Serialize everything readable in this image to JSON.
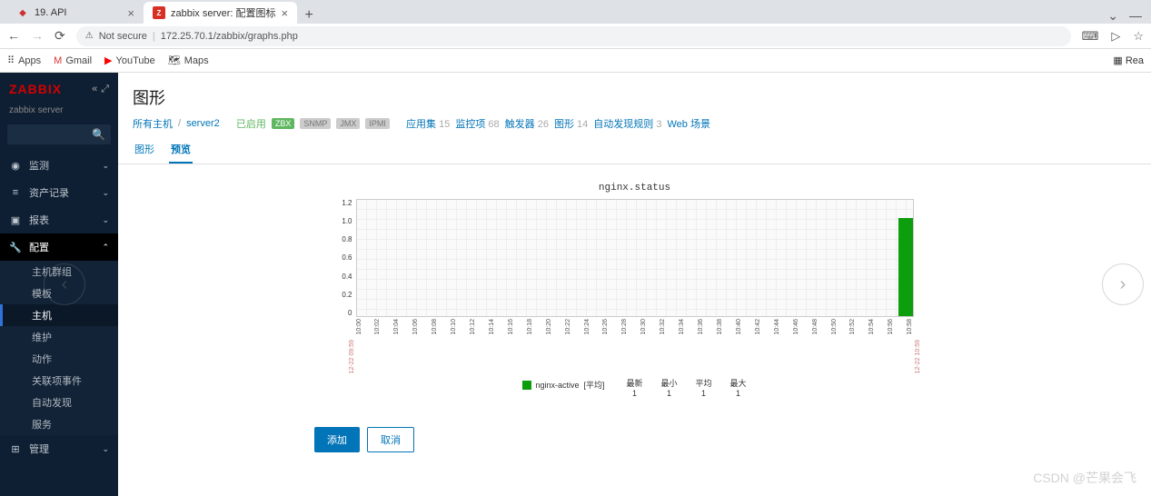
{
  "browser": {
    "tabs": [
      {
        "title": "19. API",
        "icon": "•"
      },
      {
        "title": "zabbix server: 配置图标",
        "icon": "Z"
      }
    ],
    "new_tab": "+",
    "nav": {
      "back": "←",
      "fwd": "→",
      "reload": "⟳"
    },
    "insecure": "Not secure",
    "url": "172.25.70.1/zabbix/graphs.php",
    "bookmarks": {
      "apps": "Apps",
      "gmail": "Gmail",
      "youtube": "YouTube",
      "maps": "Maps",
      "reading": "Rea"
    }
  },
  "sidebar": {
    "logo": "ZABBIX",
    "server": "zabbix server",
    "items": [
      {
        "icon": "◉",
        "label": "监测"
      },
      {
        "icon": "≡",
        "label": "资产记录"
      },
      {
        "icon": "▣",
        "label": "报表"
      },
      {
        "icon": "🔧",
        "label": "配置"
      },
      {
        "icon": "⊞",
        "label": "管理"
      }
    ],
    "sub": [
      {
        "label": "主机群组"
      },
      {
        "label": "模板"
      },
      {
        "label": "主机"
      },
      {
        "label": "维护"
      },
      {
        "label": "动作"
      },
      {
        "label": "关联项事件"
      },
      {
        "label": "自动发现"
      },
      {
        "label": "服务"
      }
    ]
  },
  "page": {
    "title": "图形",
    "breadcrumb": {
      "all_hosts": "所有主机",
      "host": "server2",
      "enabled": "已启用",
      "zbx": "ZBX",
      "snmp": "SNMP",
      "jmx": "JMX",
      "ipmi": "IPMI",
      "apps": "应用集",
      "apps_n": "15",
      "items": "监控项",
      "items_n": "68",
      "triggers": "触发器",
      "triggers_n": "26",
      "graphs": "图形",
      "graphs_n": "14",
      "discovery": "自动发现规则",
      "discovery_n": "3",
      "web": "Web 场景"
    },
    "subtabs": {
      "graph": "图形",
      "preview": "预览"
    },
    "buttons": {
      "add": "添加",
      "cancel": "取消"
    }
  },
  "chart_data": {
    "type": "bar",
    "title": "nginx.status",
    "ylim": [
      0,
      1.2
    ],
    "y_ticks": [
      "1.2",
      "1.0",
      "0.8",
      "0.6",
      "0.4",
      "0.2",
      "0"
    ],
    "x_start": "12-22 09:59",
    "x_end": "12-22 10:59",
    "x_ticks": [
      "10:00",
      "10:02",
      "10:04",
      "10:06",
      "10:08",
      "10:10",
      "10:12",
      "10:14",
      "10:16",
      "10:18",
      "10:20",
      "10:22",
      "10:24",
      "10:26",
      "10:28",
      "10:30",
      "10:32",
      "10:34",
      "10:36",
      "10:38",
      "10:40",
      "10:42",
      "10:44",
      "10:46",
      "10:48",
      "10:50",
      "10:52",
      "10:54",
      "10:56",
      "10:58"
    ],
    "series": [
      {
        "name": "nginx-active",
        "color": "#0d9e0d",
        "agg": "[平均]",
        "latest": 1,
        "min": 1,
        "avg": 1,
        "max": 1
      }
    ],
    "legend_headers": {
      "latest": "最新",
      "min": "最小",
      "avg": "平均",
      "max": "最大"
    }
  },
  "watermark": "CSDN @芒果会飞"
}
